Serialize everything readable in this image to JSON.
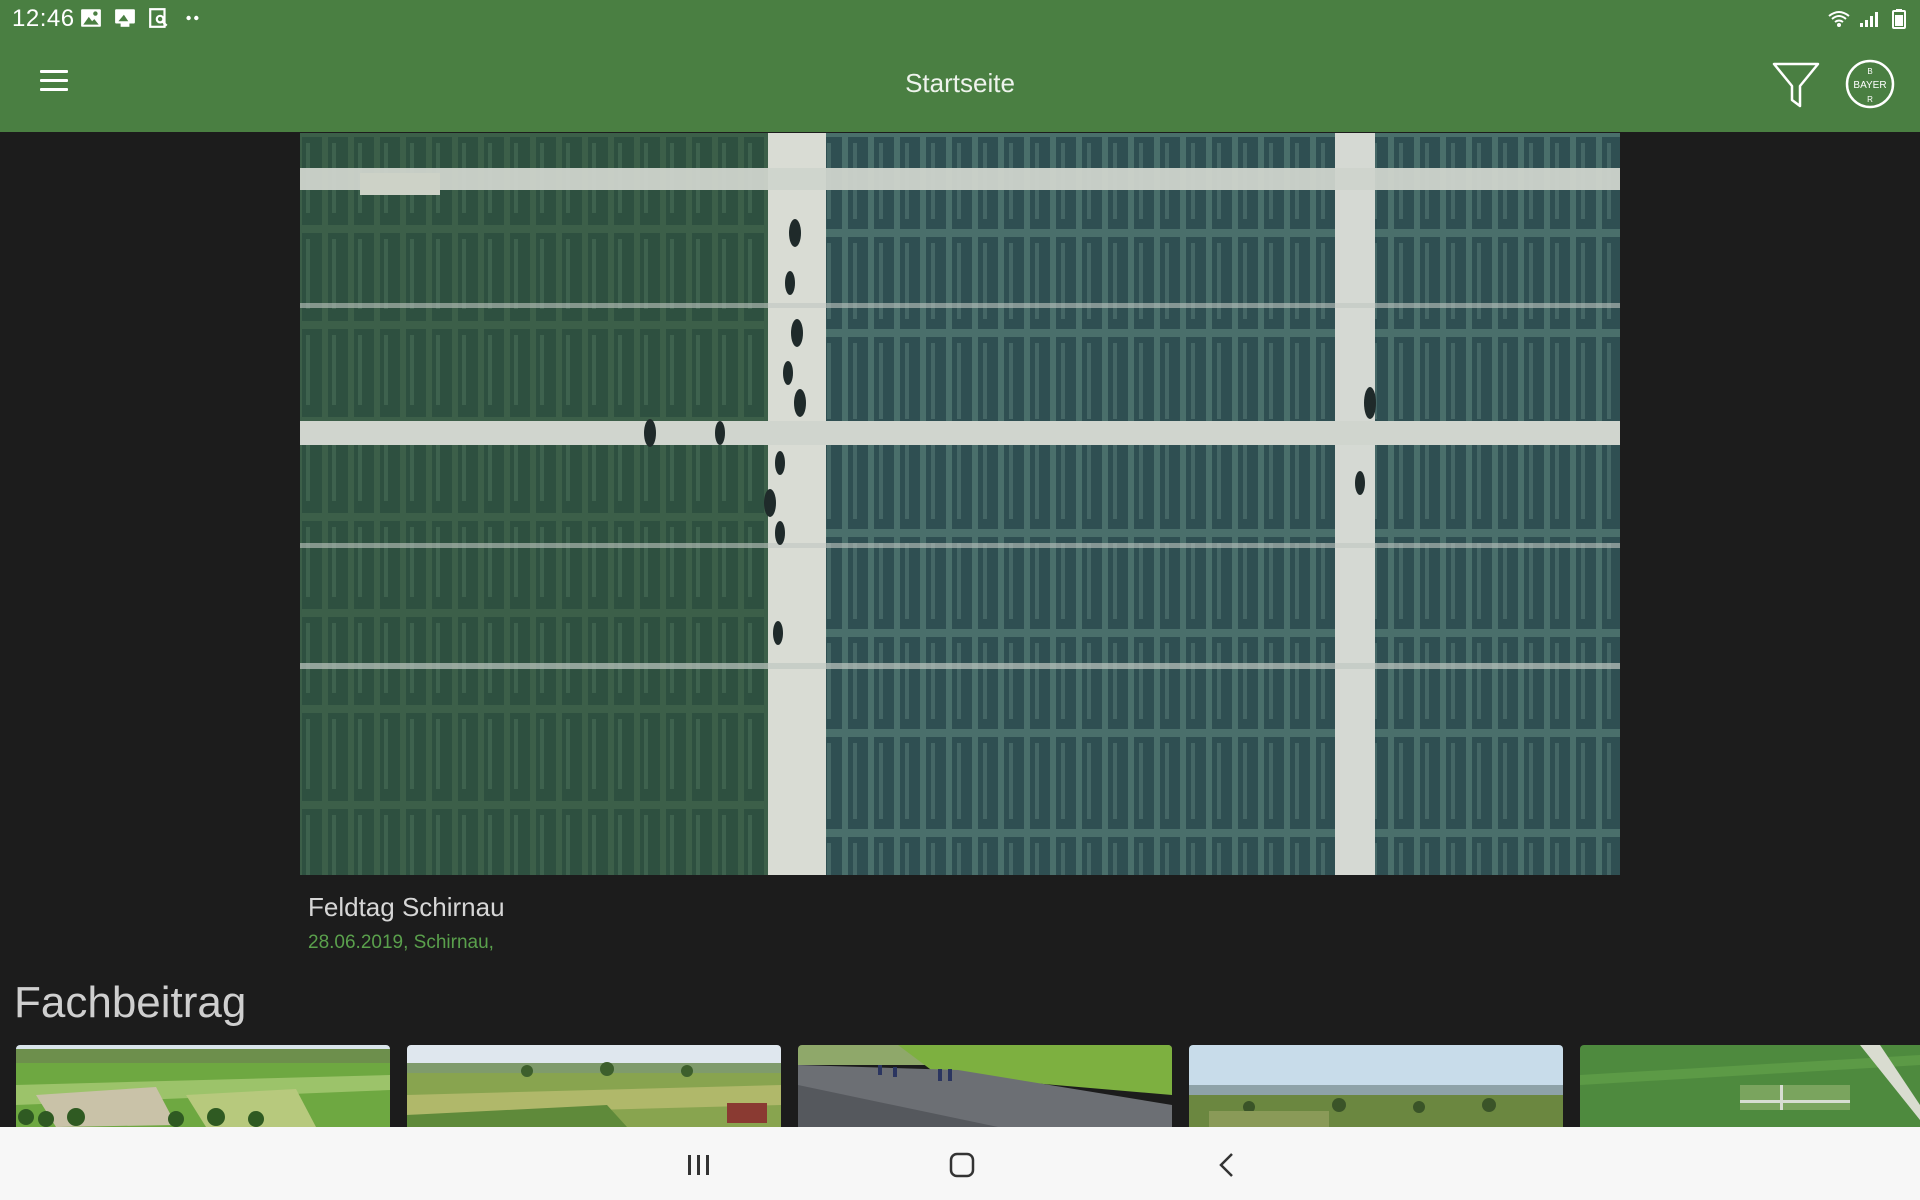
{
  "status_bar": {
    "time": "12:46",
    "left_icons": [
      "image-icon",
      "photo-upload-icon",
      "search-doc-icon",
      "more-dots-icon"
    ],
    "right_icons": [
      "wifi-icon",
      "signal-icon",
      "battery-icon"
    ]
  },
  "app_bar": {
    "title": "Startseite",
    "menu_icon": "hamburger-icon",
    "filter_icon": "filter-icon",
    "logo_text": "BAYER"
  },
  "featured": {
    "title": "Feldtag Schirnau",
    "meta": "28.06.2019, Schirnau,"
  },
  "section": {
    "heading": "Fachbeitrag"
  },
  "thumbnails": [
    {
      "scene": "aerial field with tree line"
    },
    {
      "scene": "rural landscape with village"
    },
    {
      "scene": "road beside crop field"
    },
    {
      "scene": "wide panorama hills"
    },
    {
      "scene": "aerial trial plots"
    }
  ],
  "nav_bar": {
    "icons": [
      "recent-apps-icon",
      "home-icon",
      "back-icon"
    ]
  },
  "colors": {
    "brand_green": "#4a7f42",
    "background": "#1c1c1c",
    "meta_green": "#5aa04c"
  }
}
